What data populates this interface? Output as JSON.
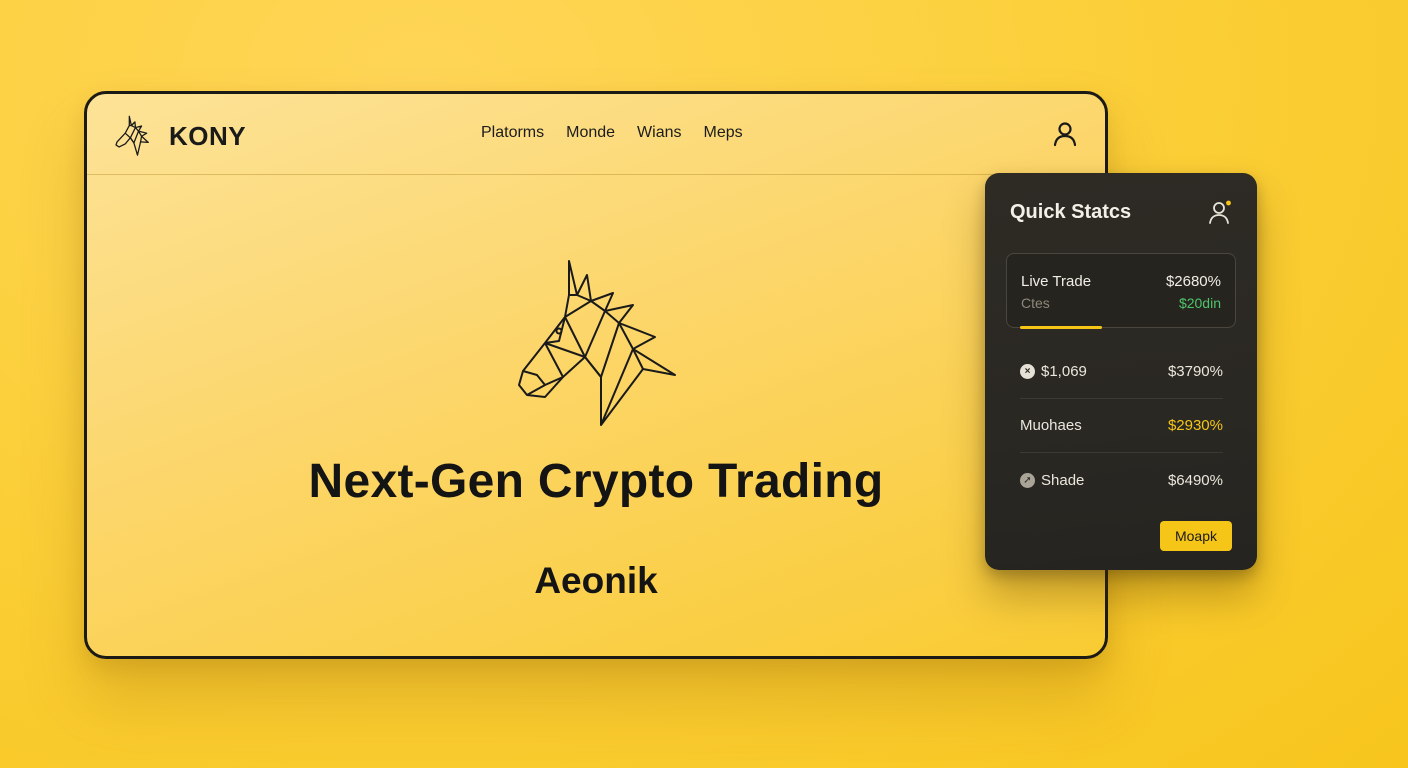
{
  "colors": {
    "background": "#f9cb32",
    "panel": "#2a2823",
    "accent": "#f5c518",
    "positive": "#4fc36a"
  },
  "header": {
    "brand": "KONY",
    "nav": [
      "Platorms",
      "Monde",
      "Wians",
      "Meps"
    ],
    "user_icon": "user-icon"
  },
  "hero": {
    "logo_icon": "horse-head-icon",
    "title": "Next-Gen Crypto Trading",
    "subtitle": "Aeonik"
  },
  "stats": {
    "title": "Quick Statcs",
    "user_icon": "user-plus-icon",
    "live": {
      "label": "Live Trade",
      "value": "$2680%",
      "sublabel": "Ctes",
      "subvalue": "$20din",
      "progress": 0.36
    },
    "rows": [
      {
        "icon": "close-circle-icon",
        "label": "$1,069",
        "value": "$3790%",
        "accent": false
      },
      {
        "icon": "",
        "label": "Muohaes",
        "value": "$2930%",
        "accent": true
      },
      {
        "icon": "arrow-circle-icon",
        "label": "Shade",
        "value": "$6490%",
        "accent": false
      }
    ],
    "button": "Moapk"
  }
}
